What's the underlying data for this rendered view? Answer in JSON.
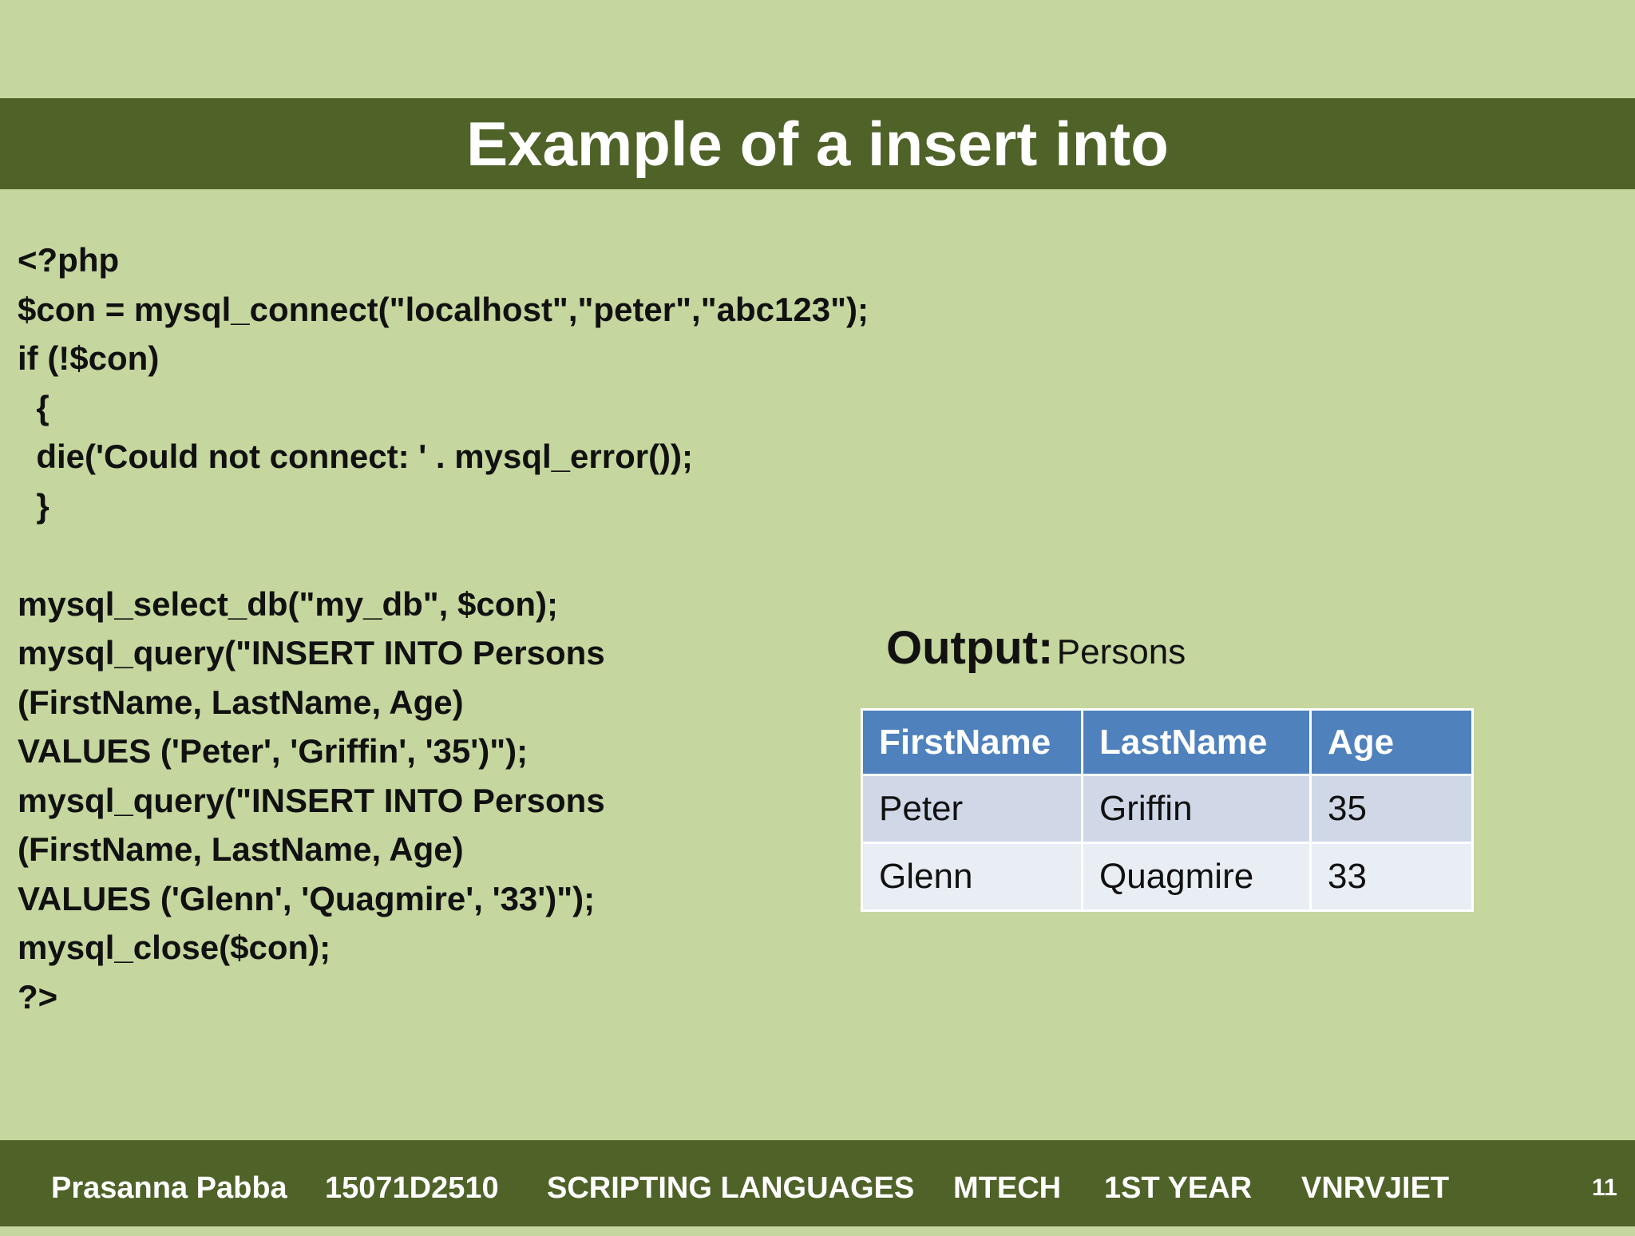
{
  "slide": {
    "title": "Example of a insert into",
    "code_lines": [
      "<?php",
      "$con = mysql_connect(\"localhost\",\"peter\",\"abc123\");",
      "if (!$con)",
      "  {",
      "  die('Could not connect: ' . mysql_error());",
      "  }",
      "",
      "mysql_select_db(\"my_db\", $con);",
      "mysql_query(\"INSERT INTO Persons",
      "(FirstName, LastName, Age)",
      "VALUES ('Peter', 'Griffin', '35')\");",
      "mysql_query(\"INSERT INTO Persons",
      "(FirstName, LastName, Age)",
      "VALUES ('Glenn', 'Quagmire', '33')\");",
      "mysql_close($con);",
      "?>"
    ],
    "output": {
      "label": "Output:",
      "table_name": "Persons",
      "headers": [
        "FirstName",
        "LastName",
        "Age"
      ],
      "rows": [
        [
          "Peter",
          "Griffin",
          "35"
        ],
        [
          "Glenn",
          "Quagmire",
          "33"
        ]
      ]
    }
  },
  "footer": {
    "author": "Prasanna Pabba",
    "roll_no": "15071D2510",
    "subject": "SCRIPTING LANGUAGES",
    "course": "MTECH",
    "year": "1ST YEAR",
    "college": "VNRVJIET",
    "page_number": "11"
  },
  "colors": {
    "background": "#c5d69e",
    "bar": "#4f6228",
    "table_header": "#4f81bd",
    "table_row_1": "#d0d8e8",
    "table_row_2": "#e9edf4"
  }
}
